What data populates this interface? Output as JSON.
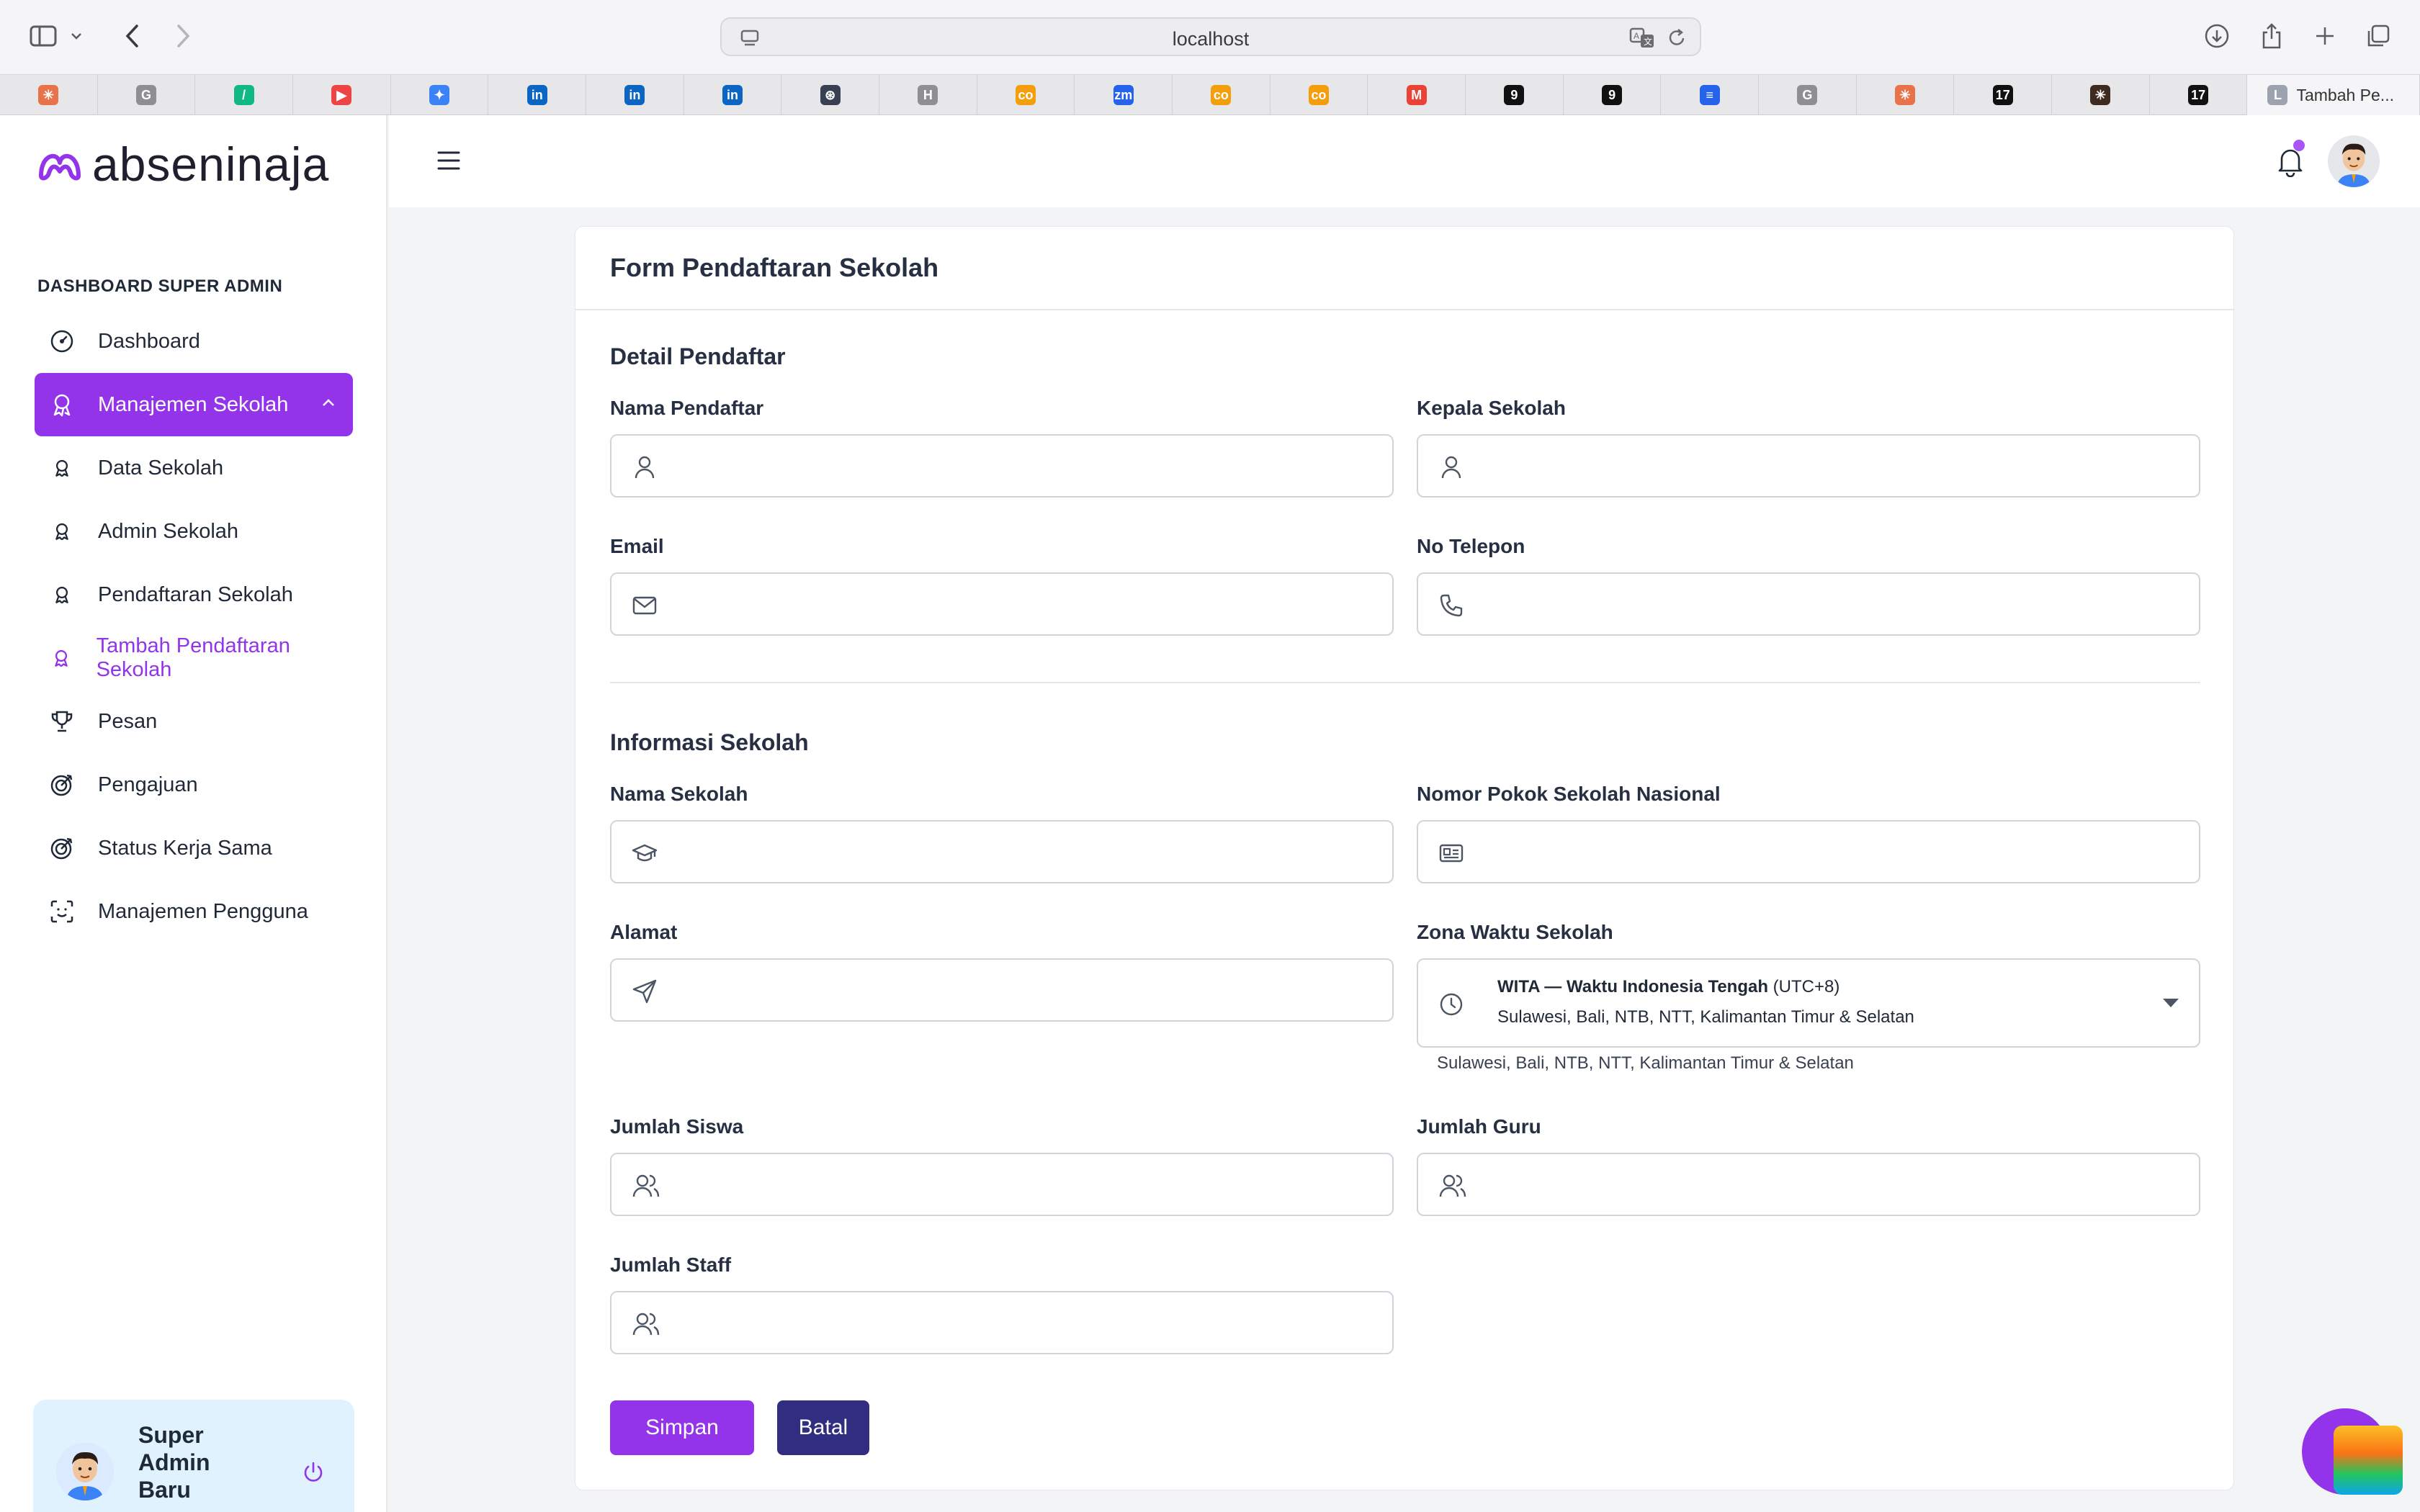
{
  "browser": {
    "address": "localhost",
    "active_tab_title": "Tambah Pe...",
    "active_tab_icon_letter": "L",
    "tabs": [
      {
        "icon": "claude-icon",
        "color": "#e8734a",
        "glyph": "✳"
      },
      {
        "icon": "g-letter-icon",
        "color": "#8e8e93",
        "glyph": "G"
      },
      {
        "icon": "slash-app-icon",
        "color": "#10b981",
        "glyph": "/"
      },
      {
        "icon": "youtube-icon",
        "color": "#ef4444",
        "glyph": "▶"
      },
      {
        "icon": "gemini-icon",
        "color": "#3b82f6",
        "glyph": "✦"
      },
      {
        "icon": "linkedin-icon",
        "color": "#0a66c2",
        "glyph": "in"
      },
      {
        "icon": "linkedin-icon",
        "color": "#0a66c2",
        "glyph": "in"
      },
      {
        "icon": "linkedin-icon",
        "color": "#0a66c2",
        "glyph": "in"
      },
      {
        "icon": "openai-icon",
        "color": "#374151",
        "glyph": "⊛"
      },
      {
        "icon": "h-letter-icon",
        "color": "#8e8e93",
        "glyph": "H"
      },
      {
        "icon": "infinity-icon",
        "color": "#f59e0b",
        "glyph": "co"
      },
      {
        "icon": "zoom-icon",
        "color": "#2563eb",
        "glyph": "zm"
      },
      {
        "icon": "infinity-icon",
        "color": "#f59e0b",
        "glyph": "co"
      },
      {
        "icon": "infinity-icon",
        "color": "#f59e0b",
        "glyph": "co"
      },
      {
        "icon": "gmail-icon",
        "color": "#ea4335",
        "glyph": "M"
      },
      {
        "icon": "nine-icon",
        "color": "#111111",
        "glyph": "9"
      },
      {
        "icon": "nine-icon",
        "color": "#111111",
        "glyph": "9"
      },
      {
        "icon": "google-docs-icon",
        "color": "#2563eb",
        "glyph": "≡"
      },
      {
        "icon": "g-letter-icon",
        "color": "#8e8e93",
        "glyph": "G"
      },
      {
        "icon": "claude-icon",
        "color": "#e8734a",
        "glyph": "✳"
      },
      {
        "icon": "tradingview-icon",
        "color": "#111111",
        "glyph": "17"
      },
      {
        "icon": "claude-dark-icon",
        "color": "#3f2a1f",
        "glyph": "✳"
      },
      {
        "icon": "tradingview-icon",
        "color": "#111111",
        "glyph": "17"
      }
    ]
  },
  "brand": {
    "name": "abseninaja",
    "accent": "#9333ea"
  },
  "sidebar": {
    "section_title": "DASHBOARD SUPER ADMIN",
    "items": [
      {
        "label": "Dashboard",
        "icon": "gauge-icon"
      },
      {
        "label": "Manajemen Sekolah",
        "icon": "award-icon"
      },
      {
        "label": "Data Sekolah",
        "icon": "award-small-icon"
      },
      {
        "label": "Admin Sekolah",
        "icon": "award-small-icon"
      },
      {
        "label": "Pendaftaran Sekolah",
        "icon": "award-small-icon"
      },
      {
        "label": "Tambah Pendaftaran Sekolah",
        "icon": "award-small-icon"
      },
      {
        "label": "Pesan",
        "icon": "trophy-icon"
      },
      {
        "label": "Pengajuan",
        "icon": "target-icon"
      },
      {
        "label": "Status Kerja Sama",
        "icon": "target-icon"
      },
      {
        "label": "Manajemen Pengguna",
        "icon": "face-scan-icon"
      }
    ],
    "user": {
      "name": "Super Admin Baru"
    }
  },
  "form": {
    "title": "Form Pendaftaran Sekolah",
    "section1": "Detail Pendaftar",
    "section2": "Informasi Sekolah",
    "fields": {
      "nama_pendaftar": {
        "label": "Nama Pendaftar",
        "value": "",
        "icon": "user-icon"
      },
      "kepala_sekolah": {
        "label": "Kepala Sekolah",
        "value": "",
        "icon": "user-icon"
      },
      "email": {
        "label": "Email",
        "value": "",
        "icon": "mail-icon"
      },
      "no_telepon": {
        "label": "No Telepon",
        "value": "",
        "icon": "phone-icon"
      },
      "nama_sekolah": {
        "label": "Nama Sekolah",
        "value": "",
        "icon": "graduation-cap-icon"
      },
      "npsn": {
        "label": "Nomor Pokok Sekolah Nasional",
        "value": "",
        "icon": "id-card-icon"
      },
      "alamat": {
        "label": "Alamat",
        "value": "",
        "icon": "send-icon"
      },
      "zona_waktu": {
        "label": "Zona Waktu Sekolah",
        "selected_code": "WITA — Waktu Indonesia Tengah",
        "selected_offset": "(UTC+8)",
        "selected_region": "Sulawesi, Bali, NTB, NTT, Kalimantan Timur & Selatan",
        "help": "Sulawesi, Bali, NTB, NTT, Kalimantan Timur & Selatan",
        "icon": "clock-icon"
      },
      "jumlah_siswa": {
        "label": "Jumlah Siswa",
        "value": "",
        "icon": "users-icon"
      },
      "jumlah_guru": {
        "label": "Jumlah Guru",
        "value": "",
        "icon": "users-icon"
      },
      "jumlah_staff": {
        "label": "Jumlah Staff",
        "value": "",
        "icon": "users-icon"
      }
    },
    "buttons": {
      "save": "Simpan",
      "cancel": "Batal"
    }
  }
}
